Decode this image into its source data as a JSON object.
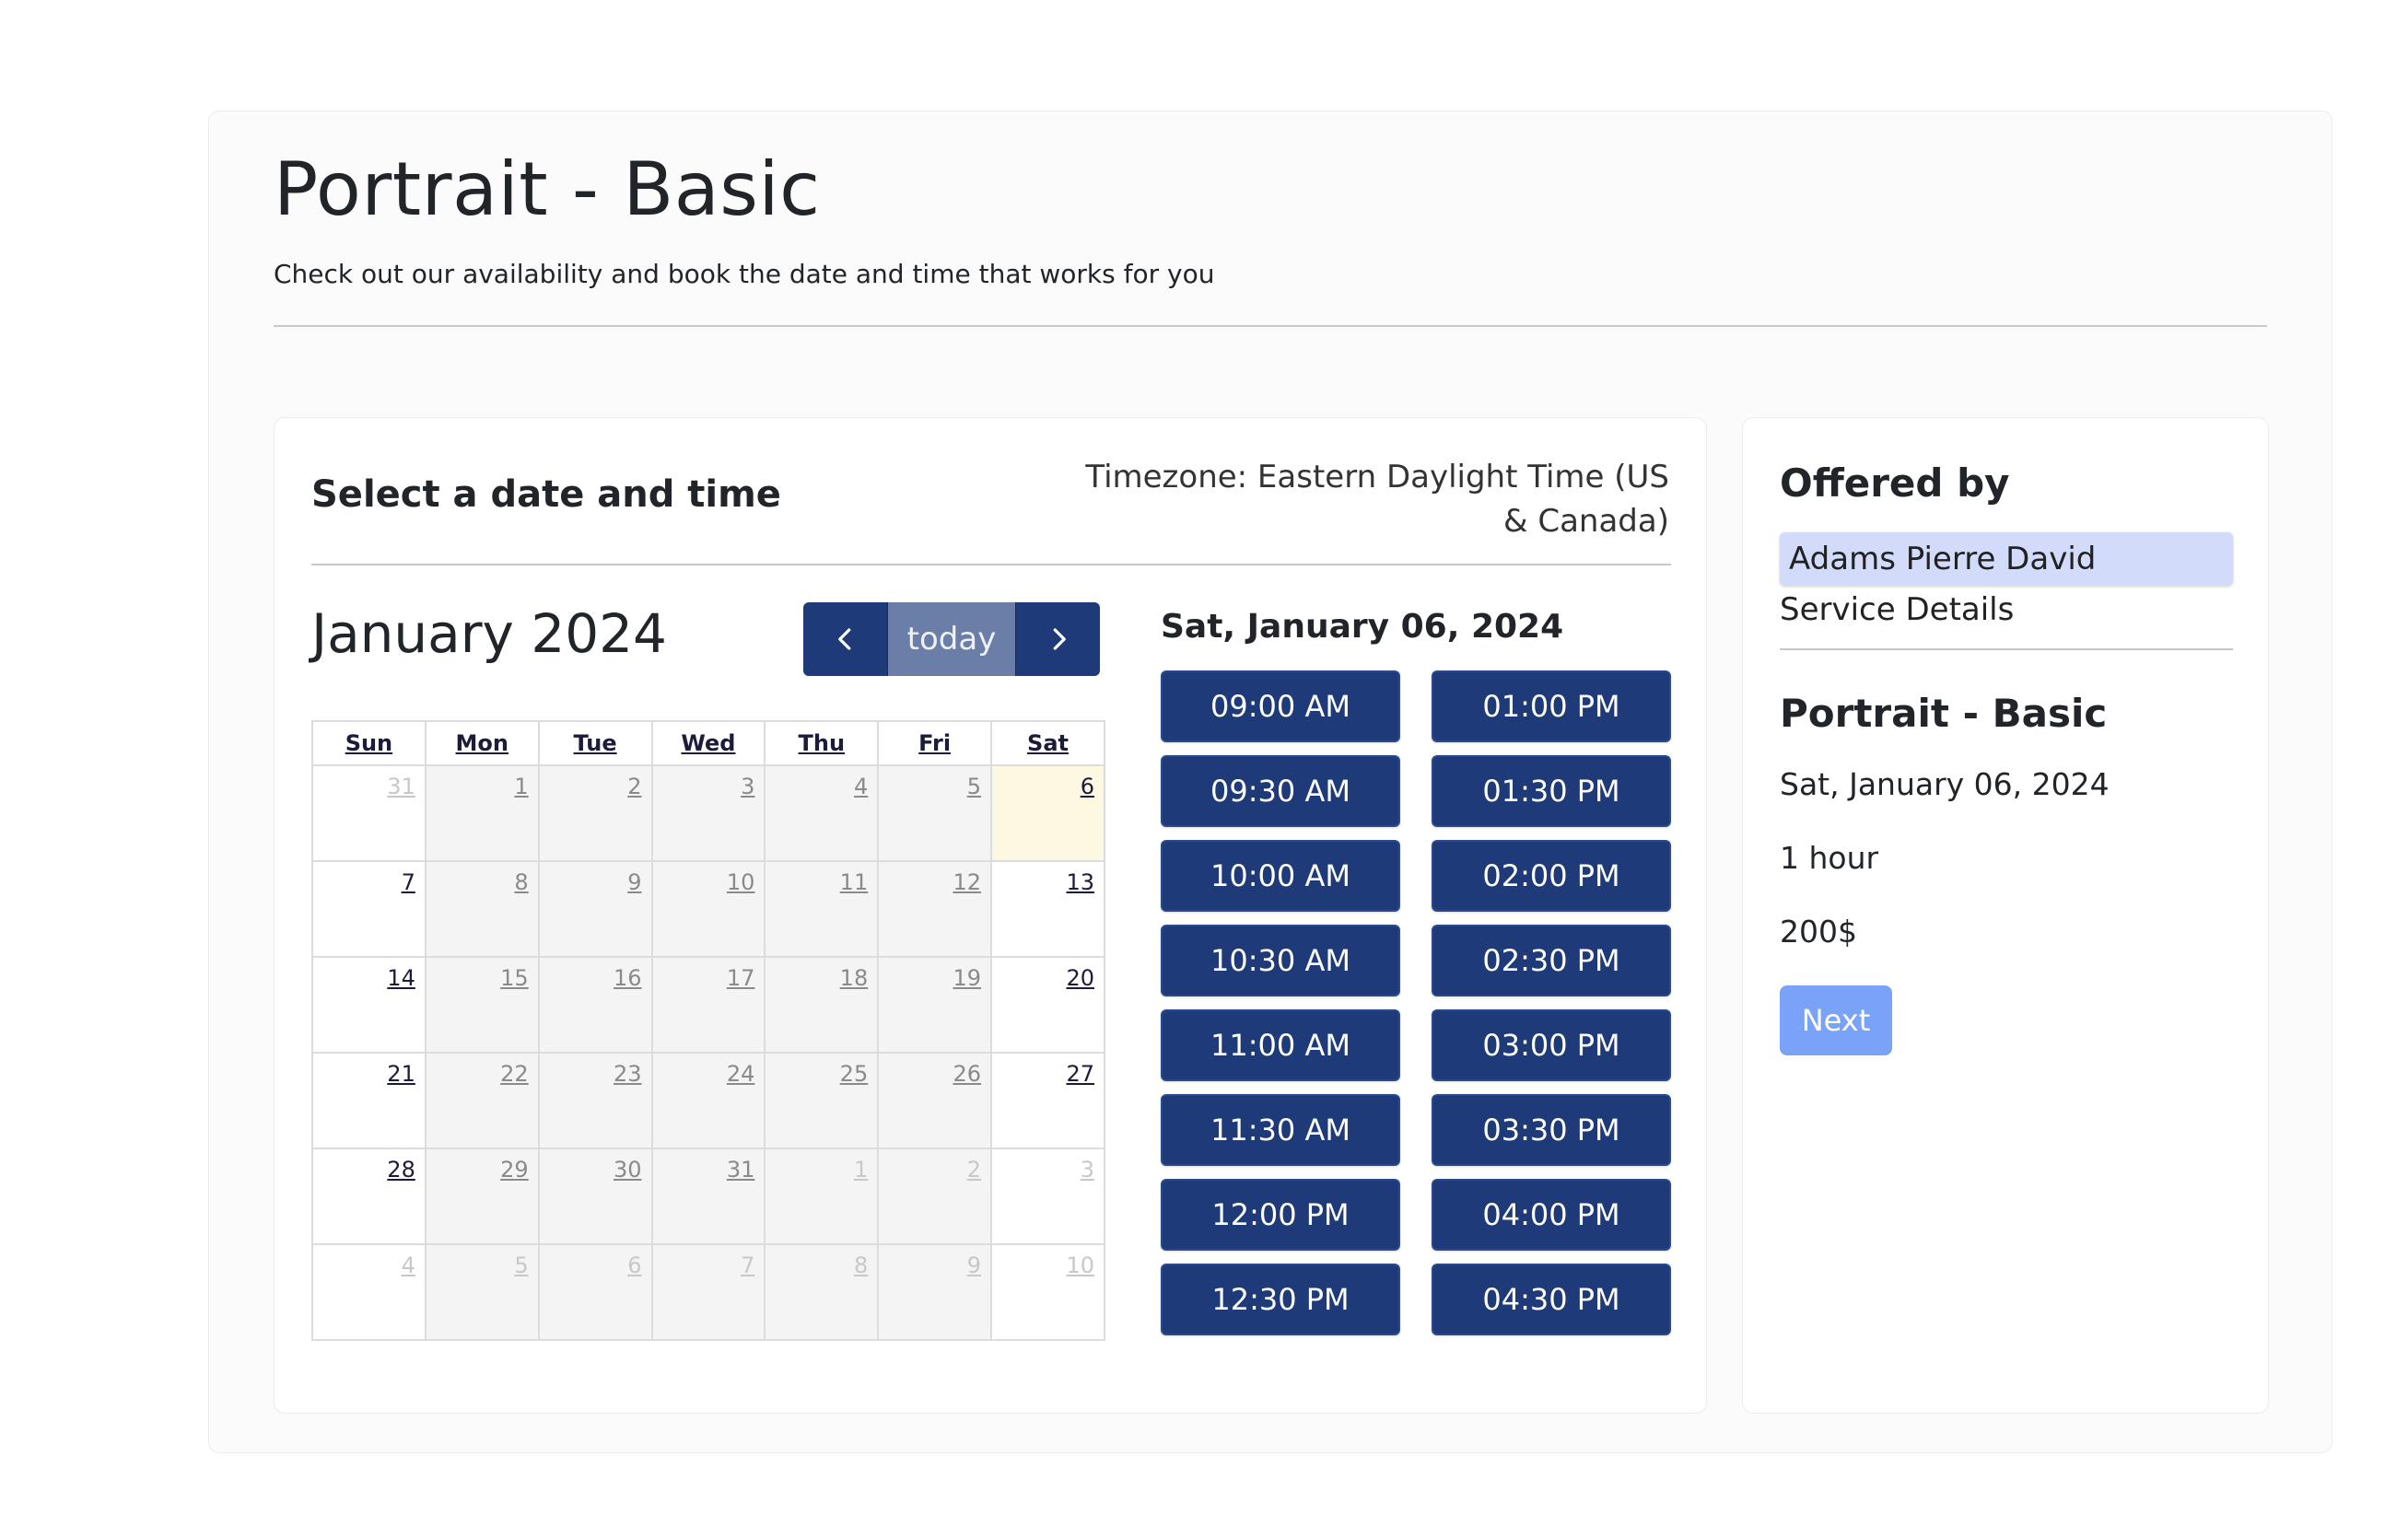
{
  "page": {
    "title": "Portrait - Basic",
    "subtitle": "Check out our availability and book the date and time that works for you"
  },
  "booking": {
    "heading": "Select a date and time",
    "timezone": "Timezone: Eastern Daylight Time (US & Canada)",
    "calendar": {
      "month_title": "January 2024",
      "today_label": "today",
      "weekdays": [
        "Sun",
        "Mon",
        "Tue",
        "Wed",
        "Thu",
        "Fri",
        "Sat"
      ],
      "weeks": [
        [
          "31",
          "1",
          "2",
          "3",
          "4",
          "5",
          "6"
        ],
        [
          "7",
          "8",
          "9",
          "10",
          "11",
          "12",
          "13"
        ],
        [
          "14",
          "15",
          "16",
          "17",
          "18",
          "19",
          "20"
        ],
        [
          "21",
          "22",
          "23",
          "24",
          "25",
          "26",
          "27"
        ],
        [
          "28",
          "29",
          "30",
          "31",
          "1",
          "2",
          "3"
        ],
        [
          "4",
          "5",
          "6",
          "7",
          "8",
          "9",
          "10"
        ]
      ],
      "selected_day": "6"
    },
    "selected_date": "Sat, January 06, 2024",
    "time_slots": [
      "09:00 AM",
      "01:00 PM",
      "09:30 AM",
      "01:30 PM",
      "10:00 AM",
      "02:00 PM",
      "10:30 AM",
      "02:30 PM",
      "11:00 AM",
      "03:00 PM",
      "11:30 AM",
      "03:30 PM",
      "12:00 PM",
      "04:00 PM",
      "12:30 PM",
      "04:30 PM"
    ]
  },
  "summary": {
    "offered_by_heading": "Offered by",
    "provider": "Adams Pierre David",
    "service_details_label": "Service Details",
    "service_title": "Portrait - Basic",
    "date": "Sat, January 06, 2024",
    "duration": "1 hour",
    "price": "200$",
    "next_label": "Next"
  },
  "colors": {
    "primary": "#1e3a78",
    "today_highlight": "#fcf8e1",
    "next_button": "#7aa2f7",
    "provider_highlight": "#d2dbfa"
  }
}
